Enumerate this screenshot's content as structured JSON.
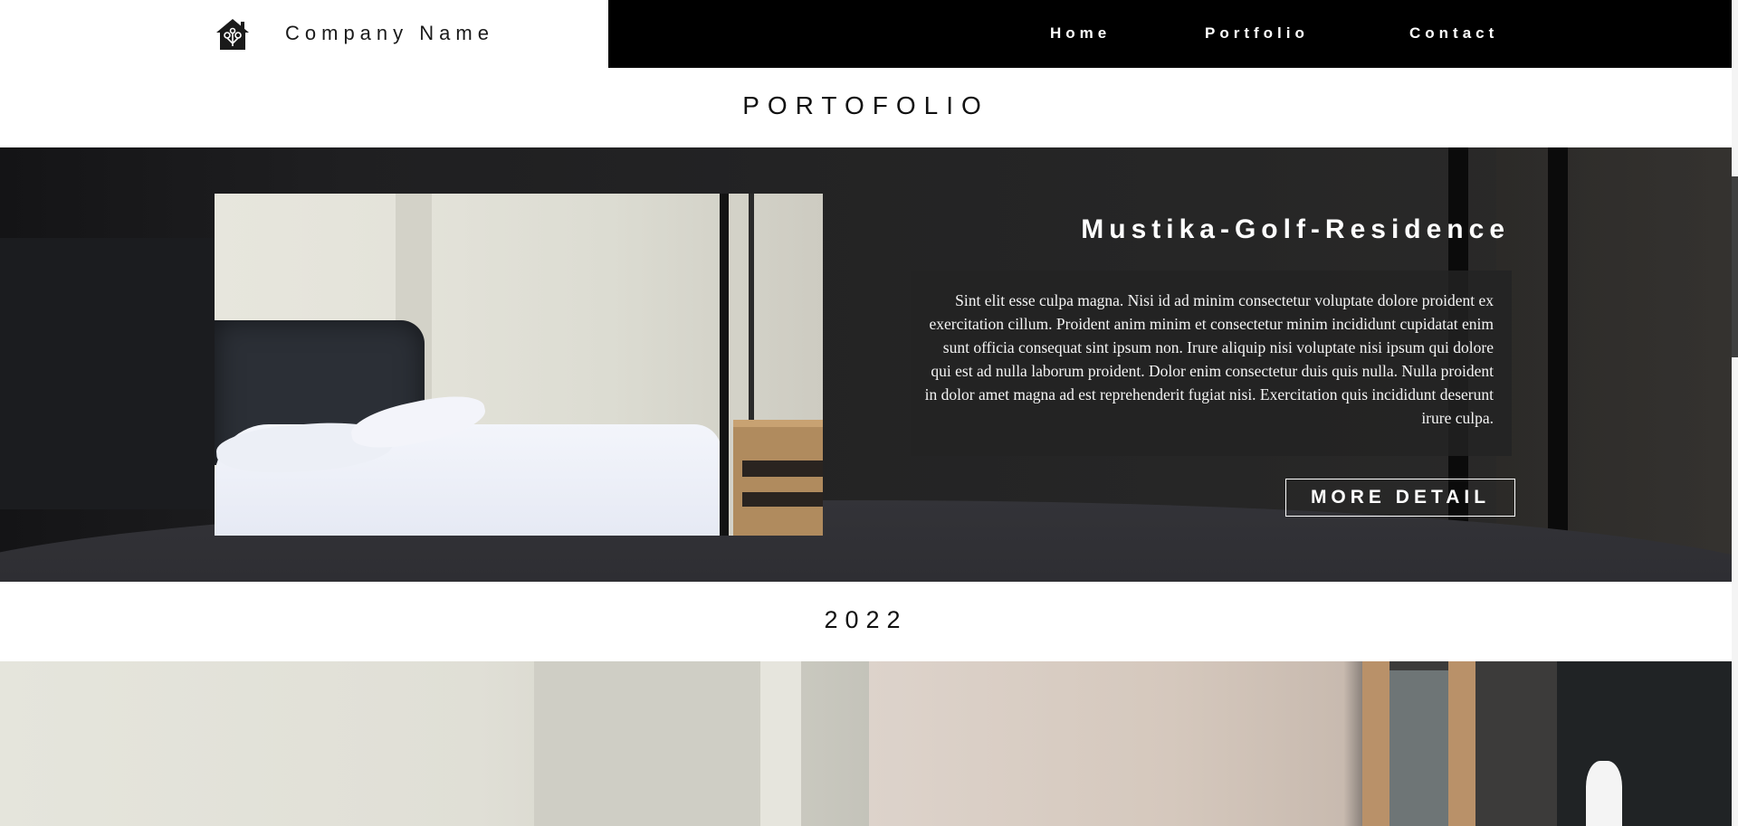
{
  "header": {
    "brand_name": "Company Name",
    "nav": [
      "Home",
      "Portfolio",
      "Contact"
    ]
  },
  "section_title": "PORTOFOLIO",
  "feature": {
    "title": "Mustika-Golf-Residence",
    "description": "Sint elit esse culpa magna. Nisi id ad minim consectetur voluptate dolore proident ex exercitation cillum. Proident anim minim et consectetur minim incididunt cupidatat enim sunt officia consequat sint ipsum non. Irure aliquip nisi voluptate nisi ipsum qui dolore qui est ad nulla laborum proident. Dolor enim consectetur duis quis nulla. Nulla proident in dolor amet magna ad est reprehenderit fugiat nisi. Exercitation quis incididunt deserunt irure culpa.",
    "button_label": "MORE DETAIL"
  },
  "year": "2022",
  "icons": {
    "logo": "house-logo-icon"
  },
  "colors": {
    "nav_bg": "#000000",
    "feature_bg": "#232324",
    "text_light": "#ffffff"
  }
}
